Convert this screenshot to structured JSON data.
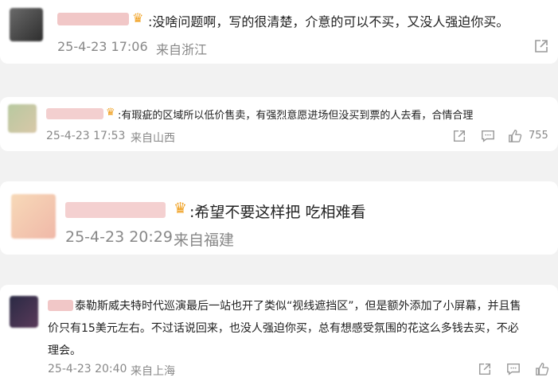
{
  "comments": [
    {
      "text": ":没啥问题啊，写的很清楚，介意的可以不买，又没人强迫你买。",
      "time": "25-4-23 17:06",
      "location": "来自浙江"
    },
    {
      "text": ":有瑕疵的区域所以低价售卖，有强烈意愿进场但没买到票的人去看，合情合理",
      "time": "25-4-23 17:53",
      "location": "来自山西",
      "likes": "755"
    },
    {
      "text": ":希望不要这样把 吃相难看",
      "time": "25-4-23 20:29",
      "location": "来自福建"
    },
    {
      "line1": "泰勒斯威夫特时代巡演最后一站也开了类似“视线遮挡区”，但是额外添加了小屏幕，并且售",
      "line2": "价只有15美元左右。不过话说回来，也没人强迫你买，总有想感受氛围的花这么多钱去买，不必",
      "line3": "理会。",
      "time": "25-4-23 20:40",
      "location": "来自上海"
    }
  ],
  "icons": {
    "share": "share-icon",
    "comment": "comment-icon",
    "like": "thumbs-up-icon",
    "vip": "vip-crown-icon"
  },
  "colors": {
    "background": "#f2f2f2",
    "card": "#ffffff",
    "text": "#222222",
    "meta": "#888888",
    "vip_badge": "#f0a020"
  }
}
